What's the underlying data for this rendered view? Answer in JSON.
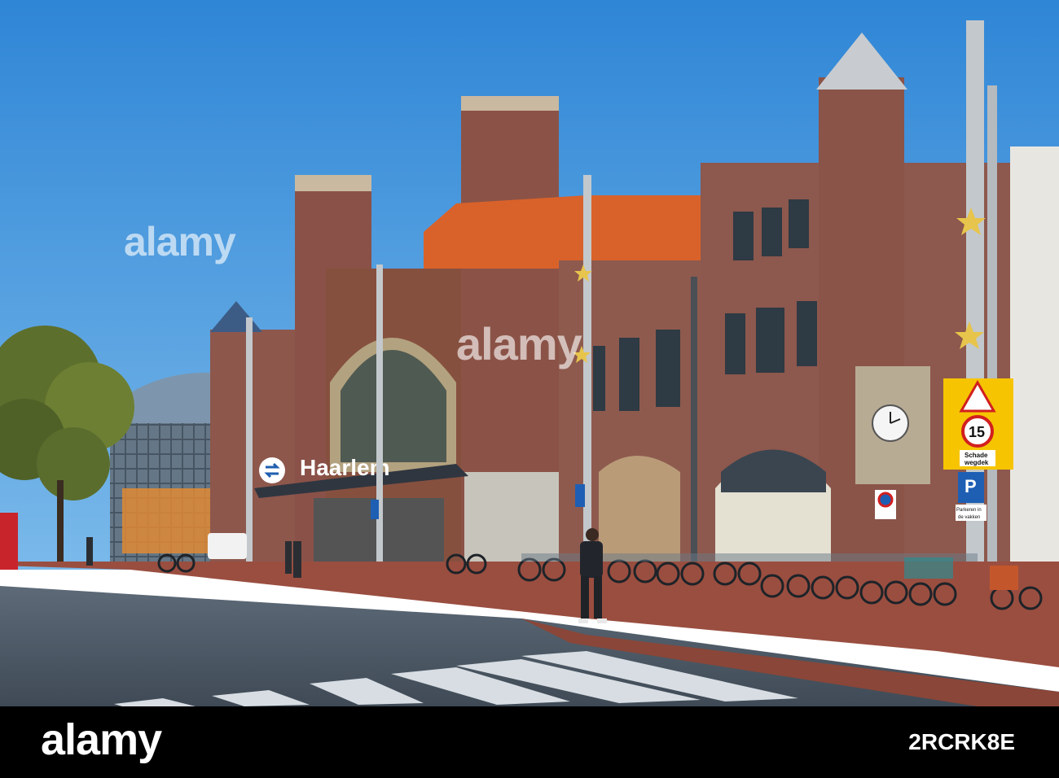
{
  "photo": {
    "station_name": "Haarlem",
    "sign_speed_limit": "15",
    "sign_warning_text_line1": "Schade",
    "sign_warning_text_line2": "wegdek",
    "parking_symbol": "P",
    "parking_text_line1": "Parkeren in",
    "parking_text_line2": "de vakken",
    "icons": [
      "ns-logo-icon",
      "parking-sign-icon",
      "clock-icon",
      "star-decoration-icon",
      "no-parking-sign-icon",
      "warning-triangle-icon"
    ]
  },
  "watermark": {
    "top_text": "alamy",
    "center_text": "alamy"
  },
  "footer": {
    "logo_text": "alamy",
    "image_id": "2RCRK8E"
  },
  "colors": {
    "sky": "#3b8fd8",
    "brick": "#8a5148",
    "roof": "#d9622a",
    "sign_yellow": "#f6c400",
    "sign_blue": "#1e5fb4",
    "road": "#4d5c6a",
    "footer_bg": "#000000"
  }
}
